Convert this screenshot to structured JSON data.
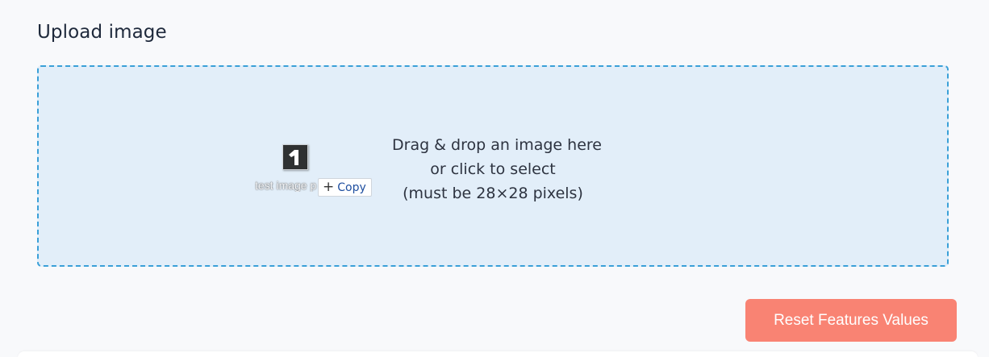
{
  "upload": {
    "title": "Upload image",
    "dropzone": {
      "line1": "Drag & drop an image here",
      "line2": "or click to select",
      "line3": "(must be 28×28 pixels)"
    },
    "drag_ghost": {
      "filename": "test image p",
      "copy_label": "Copy",
      "icon": "digit-image-thumbnail"
    }
  },
  "actions": {
    "reset_label": "Reset Features Values"
  },
  "colors": {
    "dropzone_border": "#3aa0d8",
    "dropzone_bg": "#e2eef9",
    "reset_bg": "#f98373"
  }
}
